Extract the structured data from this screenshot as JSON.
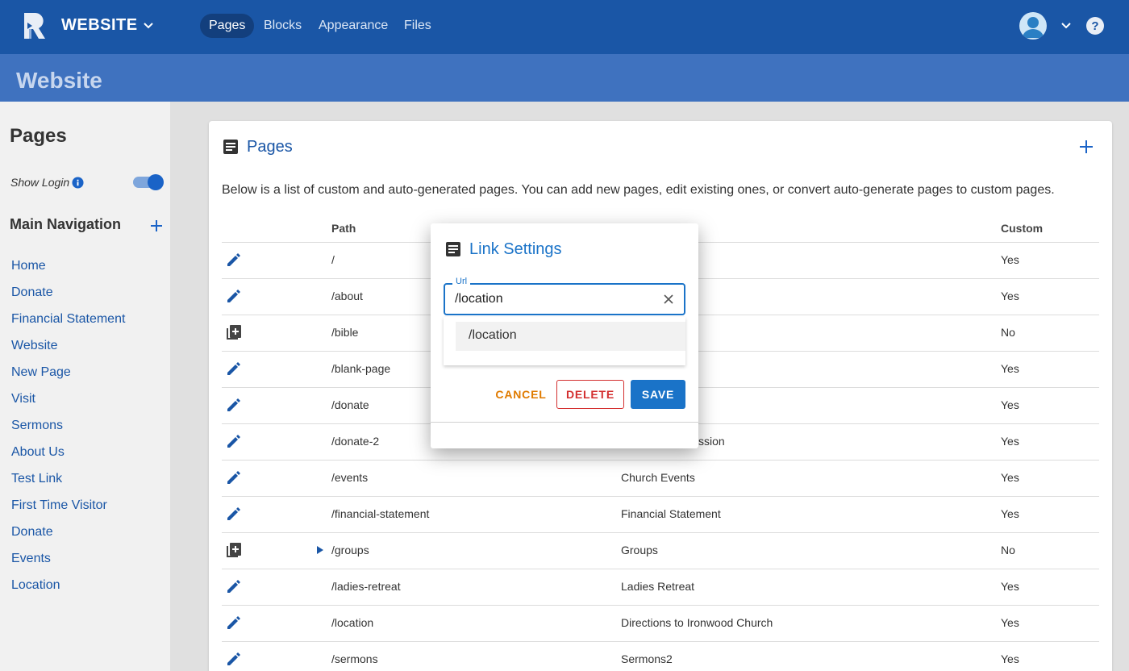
{
  "topbar": {
    "site_title": "WEBSITE",
    "nav": [
      {
        "label": "Pages",
        "active": true
      },
      {
        "label": "Blocks",
        "active": false
      },
      {
        "label": "Appearance",
        "active": false
      },
      {
        "label": "Files",
        "active": false
      }
    ]
  },
  "subheader": {
    "title": "Website"
  },
  "sidebar": {
    "title": "Pages",
    "show_login_label": "Show Login",
    "show_login_on": true,
    "main_nav_title": "Main Navigation",
    "links": [
      "Home",
      "Donate",
      "Financial Statement",
      "Website",
      "New Page",
      "Visit",
      "Sermons",
      "About Us",
      "Test Link",
      "First Time Visitor",
      "Donate",
      "Events",
      "Location"
    ]
  },
  "card": {
    "title": "Pages",
    "description": "Below is a list of custom and auto-generated pages. You can add new pages, edit existing ones, or convert auto-generate pages to custom pages.",
    "columns": {
      "path": "Path",
      "custom": "Custom"
    },
    "rows": [
      {
        "icon": "pencil-icon",
        "path": "/",
        "title": "",
        "custom": "Yes"
      },
      {
        "icon": "pencil-icon",
        "path": "/about",
        "title": "",
        "custom": "Yes"
      },
      {
        "icon": "add-page-icon",
        "path": "/bible",
        "title": "",
        "custom": "No"
      },
      {
        "icon": "pencil-icon",
        "path": "/blank-page",
        "title": "",
        "custom": "Yes"
      },
      {
        "icon": "pencil-icon",
        "path": "/donate",
        "title": "",
        "custom": "Yes"
      },
      {
        "icon": "pencil-icon",
        "path": "/donate-2",
        "title": "ssion",
        "custom": "Yes"
      },
      {
        "icon": "pencil-icon",
        "path": "/events",
        "title": "Church Events",
        "custom": "Yes"
      },
      {
        "icon": "pencil-icon",
        "path": "/financial-statement",
        "title": "Financial Statement",
        "custom": "Yes"
      },
      {
        "icon": "add-page-icon",
        "path": "/groups",
        "title": "Groups",
        "custom": "No",
        "expandable": true
      },
      {
        "icon": "pencil-icon",
        "path": "/ladies-retreat",
        "title": "Ladies Retreat",
        "custom": "Yes"
      },
      {
        "icon": "pencil-icon",
        "path": "/location",
        "title": "Directions to Ironwood Church",
        "custom": "Yes"
      },
      {
        "icon": "pencil-icon",
        "path": "/sermons",
        "title": "Sermons2",
        "custom": "Yes"
      }
    ]
  },
  "modal": {
    "title": "Link Settings",
    "url_label": "Url",
    "url_value": "/location",
    "suggestion": "/location",
    "cancel_label": "CANCEL",
    "delete_label": "DELETE",
    "save_label": "SAVE"
  },
  "colors": {
    "primary": "#1a56a6",
    "accent": "#1a73c8",
    "danger": "#d32f2f",
    "warning": "#e07b00"
  }
}
